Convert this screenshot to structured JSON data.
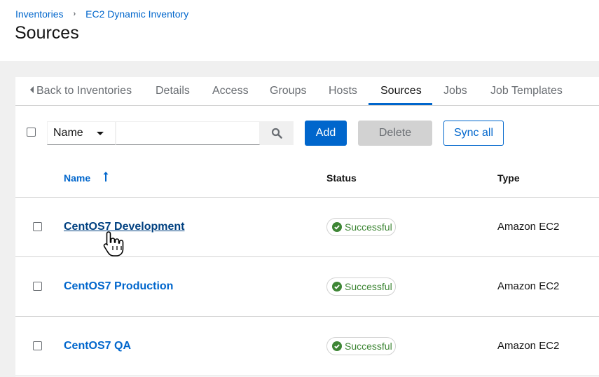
{
  "breadcrumb": [
    {
      "label": "Inventories"
    },
    {
      "label": "EC2 Dynamic Inventory"
    }
  ],
  "page_title": "Sources",
  "tabs": [
    {
      "label": "Back to Inventories",
      "icon": "caret-left-icon"
    },
    {
      "label": "Details"
    },
    {
      "label": "Access"
    },
    {
      "label": "Groups"
    },
    {
      "label": "Hosts"
    },
    {
      "label": "Sources",
      "active": true
    },
    {
      "label": "Jobs"
    },
    {
      "label": "Job Templates"
    }
  ],
  "toolbar": {
    "filter_select": "Name",
    "search_value": "",
    "search_placeholder": "",
    "add_label": "Add",
    "delete_label": "Delete",
    "sync_all_label": "Sync all"
  },
  "table": {
    "columns": [
      {
        "label": "Name",
        "sort": "ascending"
      },
      {
        "label": "Status"
      },
      {
        "label": "Type"
      }
    ],
    "rows": [
      {
        "name": "CentOS7 Development",
        "status": "Successful",
        "type": "Amazon EC2"
      },
      {
        "name": "CentOS7 Production",
        "status": "Successful",
        "type": "Amazon EC2"
      },
      {
        "name": "CentOS7 QA",
        "status": "Successful",
        "type": "Amazon EC2"
      }
    ]
  },
  "colors": {
    "link": "#0066cc",
    "primary": "#0066cc",
    "success": "#3e8635",
    "disabled_bg": "#d2d2d2"
  }
}
